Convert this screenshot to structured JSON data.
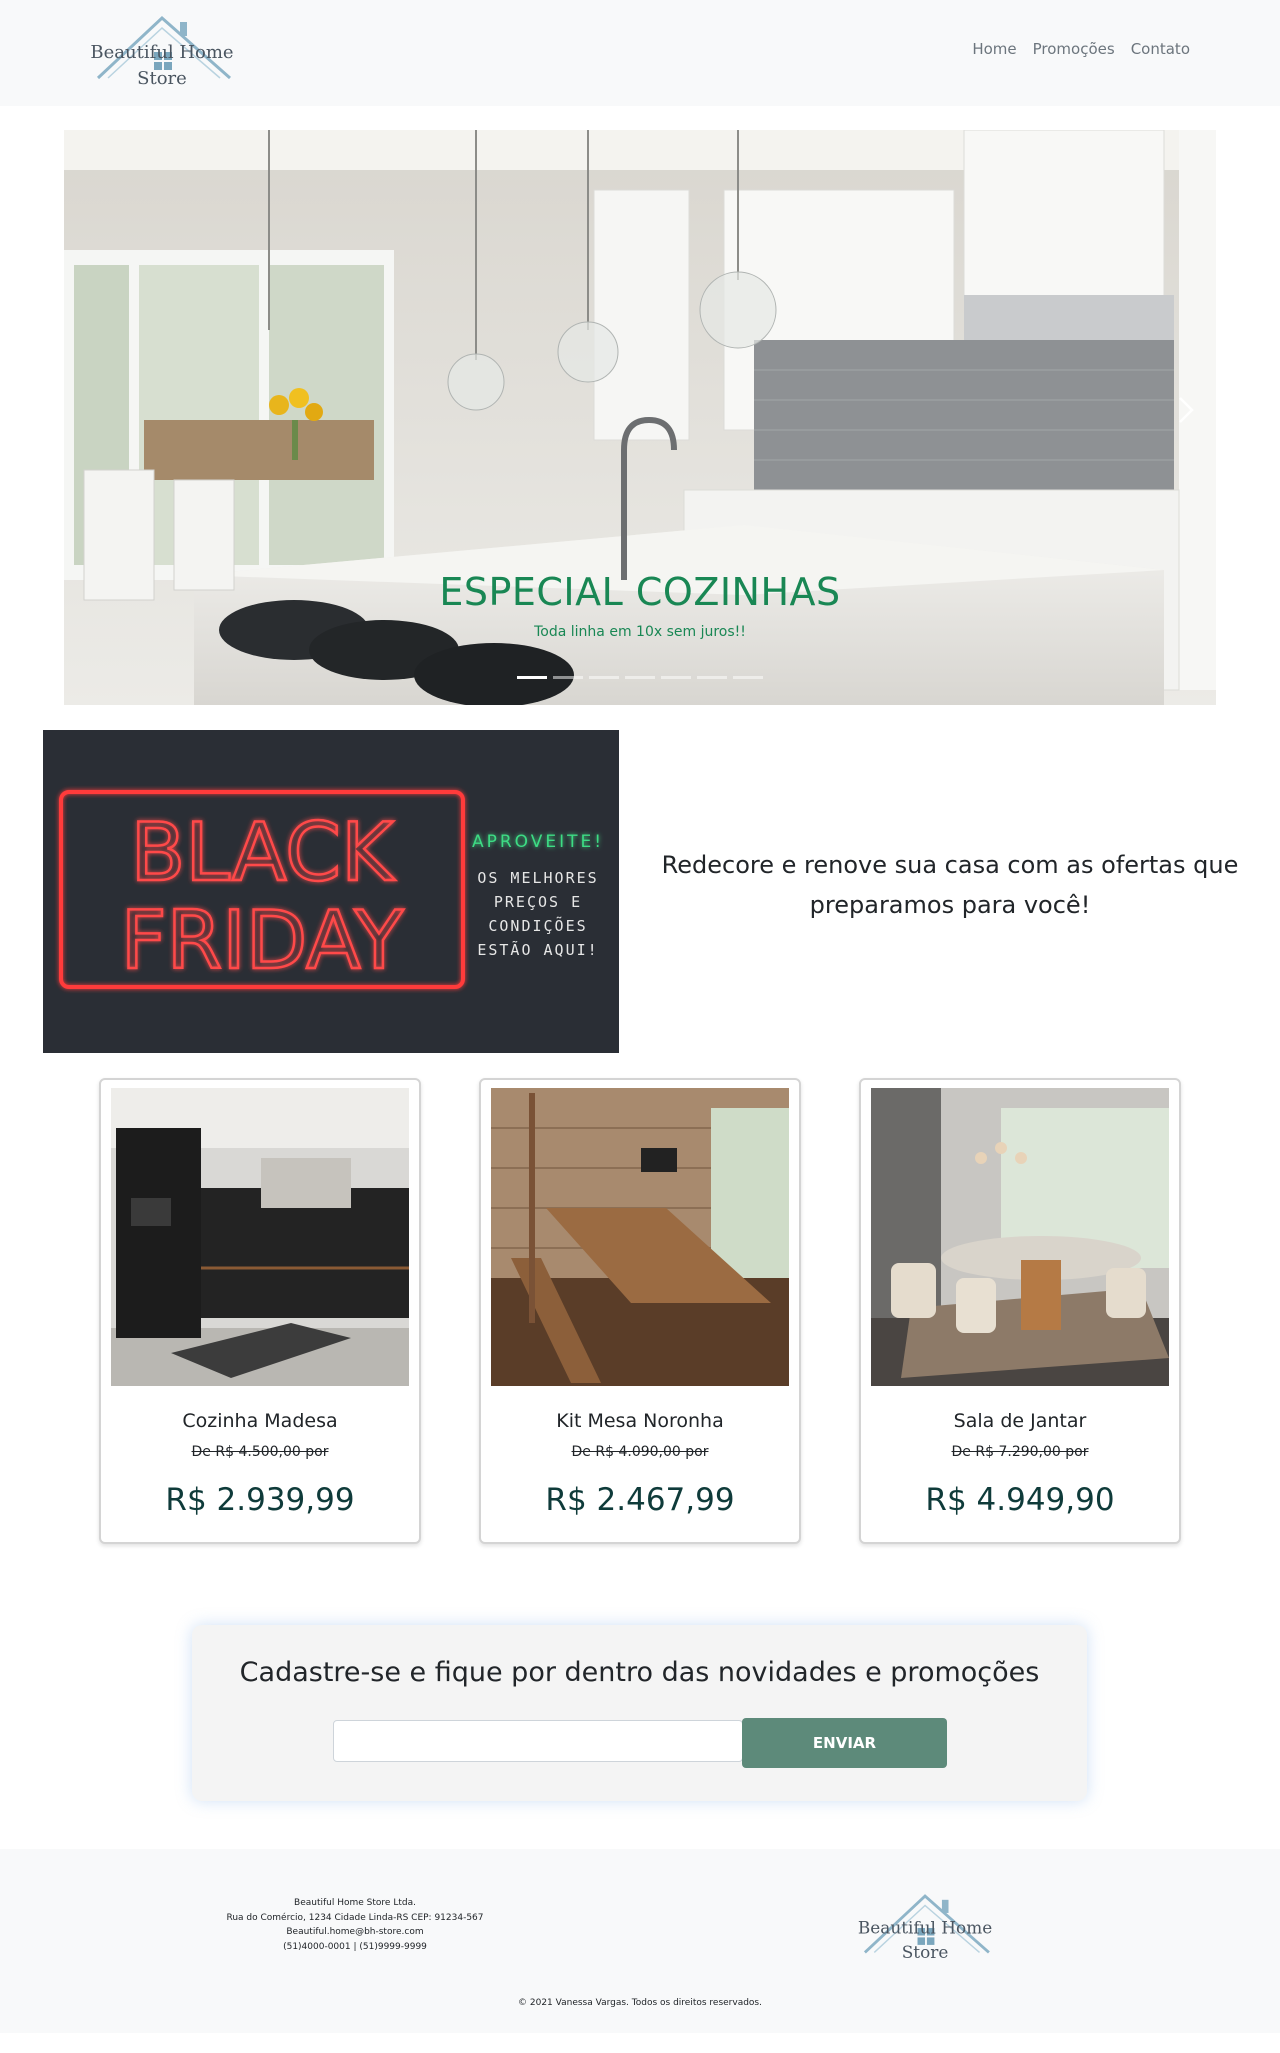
{
  "brand": {
    "logo_line1": "Beautiful Home",
    "logo_line2": "Store"
  },
  "nav": {
    "items": [
      "Home",
      "Promoções",
      "Contato"
    ]
  },
  "carousel": {
    "slide_title": "ESPECIAL COZINHAS",
    "slide_subtitle": "Toda linha em 10x sem juros!!",
    "slide_count": 7,
    "active_slide": 1
  },
  "promo": {
    "banner_words": [
      "BLACK",
      "FRIDAY",
      "APROVEITE!",
      "OS MELHORES",
      "PREÇOS E",
      "CONDIÇÕES",
      "ESTÃO AQUI!"
    ],
    "text": "Redecore e renove sua casa com as ofertas que preparamos para você!"
  },
  "products": [
    {
      "name": "Cozinha Madesa",
      "old_price": "De R$ 4.500,00 por",
      "price": "R$ 2.939,99"
    },
    {
      "name": "Kit Mesa Noronha",
      "old_price": "De R$ 4.090,00 por",
      "price": "R$ 2.467,99"
    },
    {
      "name": "Sala de Jantar",
      "old_price": "De R$ 7.290,00 por",
      "price": "R$ 4.949,90"
    }
  ],
  "newsletter": {
    "title": "Cadastre-se e fique por dentro das novidades e promoções",
    "input_value": "",
    "button_label": "ENVIAR"
  },
  "footer": {
    "company": "Beautiful Home Store Ltda.",
    "address": "Rua do Comércio, 1234 Cidade Linda-RS CEP: 91234-567",
    "email": "Beautiful.home@bh-store.com",
    "phones": "(51)4000-0001 | (51)9999-9999",
    "copyright": "© 2021 Vanessa Vargas. Todos os direitos reservados."
  },
  "colors": {
    "header_bg": "#f8f9fa",
    "caption_green": "#198754",
    "price_color": "#0f3b3a",
    "button_bg": "#5d8a7a",
    "neon_red": "#ff3b3b",
    "neon_green": "#3ddc84"
  }
}
